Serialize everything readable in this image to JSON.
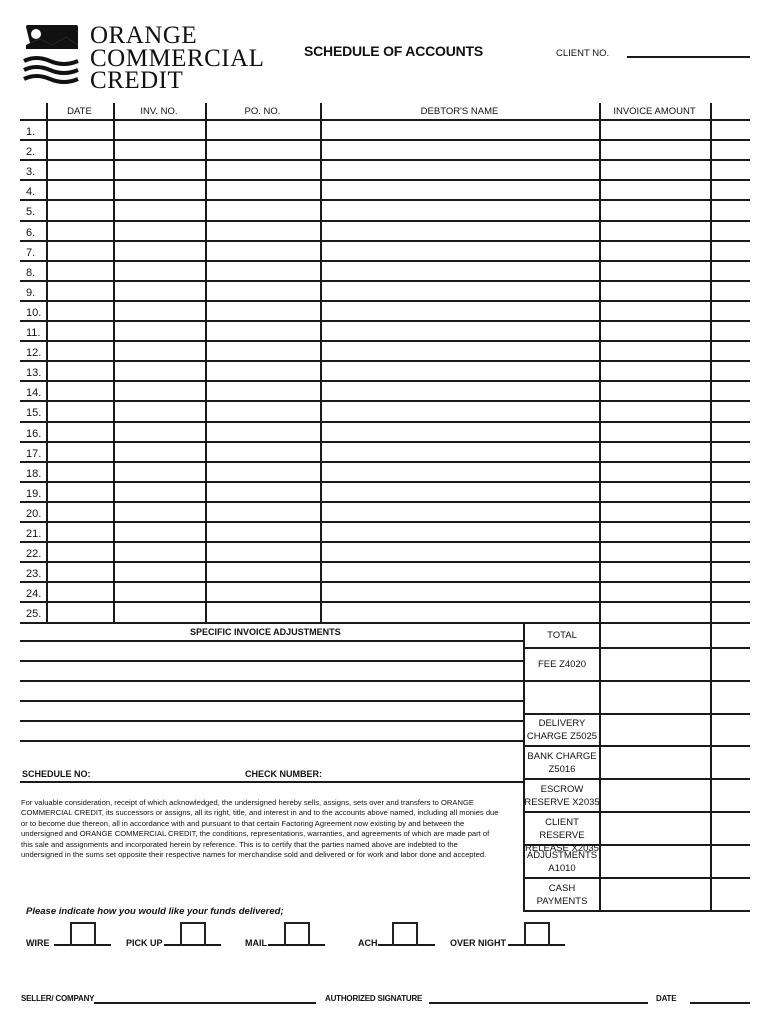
{
  "logo": {
    "line1": "ORANGE",
    "line2": "COMMERCIAL",
    "line3": "CREDIT",
    "icon": "mountain-waves-logo-icon"
  },
  "header": {
    "title": "SCHEDULE OF ACCOUNTS",
    "client_no_label": "CLIENT NO.",
    "client_no_value": ""
  },
  "table": {
    "columns": [
      "DATE",
      "INV. NO.",
      "PO. NO.",
      "DEBTOR'S NAME",
      "INVOICE AMOUNT",
      ""
    ],
    "row_numbers": [
      "1.",
      "2.",
      "3.",
      "4.",
      "5.",
      "6.",
      "7.",
      "8.",
      "9.",
      "10.",
      "11.",
      "12.",
      "13.",
      "14.",
      "15.",
      "16.",
      "17.",
      "18.",
      "19.",
      "20.",
      "21.",
      "22.",
      "23.",
      "24.",
      "25."
    ]
  },
  "adjustments": {
    "title": "SPECIFIC INVOICE ADJUSTMENTS",
    "schedule_no_label": "SCHEDULE NO:",
    "check_number_label": "CHECK NUMBER:"
  },
  "summary": {
    "rows": [
      {
        "line1": "TOTAL",
        "line2": ""
      },
      {
        "line1": "FEE Z4020",
        "line2": ""
      },
      {
        "line1": "",
        "line2": ""
      },
      {
        "line1": "DELIVERY",
        "line2": "CHARGE Z5025"
      },
      {
        "line1": "BANK CHARGE",
        "line2": "Z5016"
      },
      {
        "line1": "ESCROW",
        "line2": "RESERVE X2035"
      },
      {
        "line1": "CLIENT RESERVE",
        "line2": "RELEASE X2035"
      },
      {
        "line1": "ADJUSTMENTS",
        "line2": "A1010"
      },
      {
        "line1": "CASH",
        "line2": "PAYMENTS"
      }
    ]
  },
  "legal_text": "For valuable consideration, receipt of which acknowledged, the undersigned hereby sells, assigns, sets over and transfers to ORANGE COMMERCIAL CREDIT, its successors or assigns, all its right, title, and interest in and to the accounts above named, including all monies due or to become due thereon, all in accordance with and pursuant to that certain Factoring Agreement now existing by and between the undersigned and ORANGE COMMERCIAL CREDIT, the conditions, representations, warranties, and agreements of which are made part of this sale and assignments and incorporated herein by reference. This is to certify that the parties named above are indebted to the undersigned in the sums set opposite their respective names for merchandise sold and delivered or for work and labor done and accepted.",
  "delivery": {
    "prompt": "Please indicate how you would like your funds delivered;",
    "options": [
      {
        "label": "WIRE",
        "checked": false
      },
      {
        "label": "PICK UP",
        "checked": false
      },
      {
        "label": "MAIL",
        "checked": false
      },
      {
        "label": "ACH",
        "checked": false
      },
      {
        "label": "OVER NIGHT",
        "checked": false
      }
    ]
  },
  "signatures": {
    "seller_label": "SELLER/ COMPANY",
    "authorized_label": "AUTHORIZED SIGNATURE",
    "date_label": "DATE"
  }
}
